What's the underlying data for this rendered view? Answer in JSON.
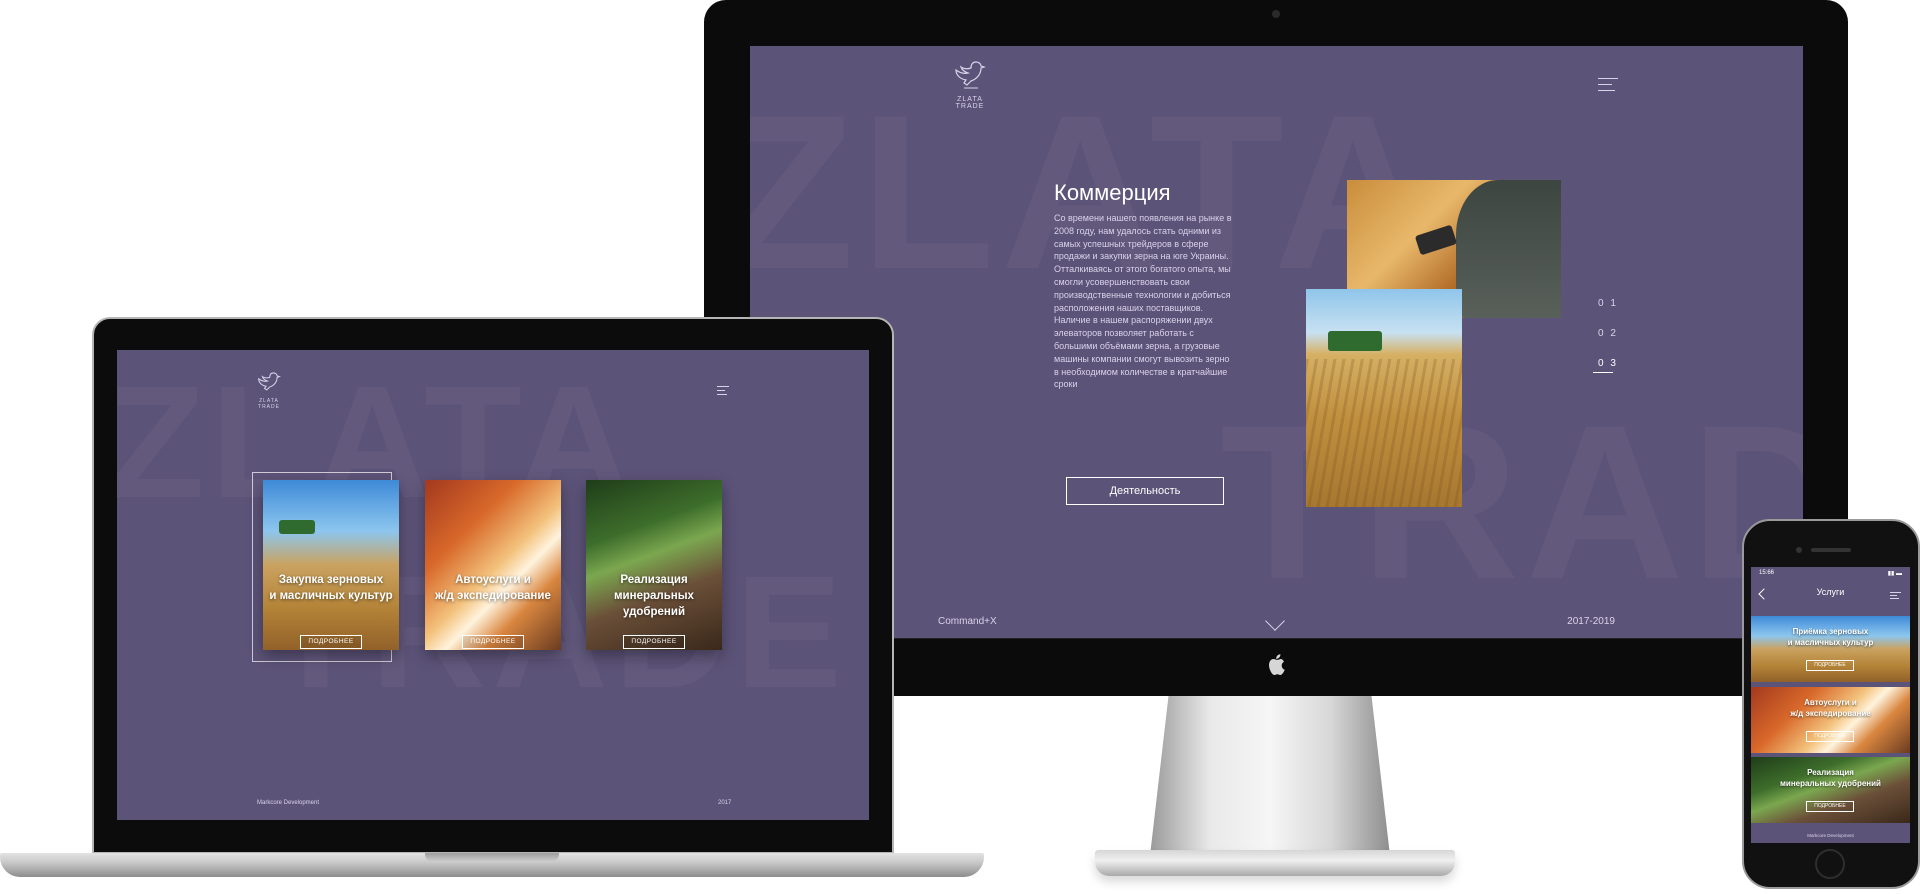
{
  "brand": {
    "logo_text": "ZLATA TRADE",
    "bg_word_1": "ZLATA",
    "bg_word_2": "TRADE"
  },
  "colors": {
    "page_bg": "#ffffff",
    "screen_bg": "#5c5378",
    "text_light": "#d9d3ea",
    "accent": "#ffffff"
  },
  "desktop": {
    "title": "Коммерция",
    "body": "Со времени нашего появления на рынке в 2008 году, нам удалось стать одними из самых успешных трейдеров в сфере продажи и закупки зерна на юге Украины. Отталкиваясь от этого богатого опыта, мы смогли усовершенствовать свои производственные технологии и добиться расположения наших поставщиков. Наличие в нашем распоряжении двух элеваторов позволяет работать с большими объёмами зерна, а грузовые машины компании смогут вывозить зерно в необходимом количестве в кратчайшие сроки",
    "button_label": "Деятельность",
    "nav": [
      "0 1",
      "0 2",
      "0 3"
    ],
    "footer_left": "Command+X",
    "footer_right": "2017-2019",
    "icons": [
      "eagle-logo-icon",
      "menu-icon",
      "chevron-down-icon",
      "apple-logo-icon"
    ]
  },
  "laptop": {
    "cards": [
      {
        "title_line1": "Закупка зерновых",
        "title_line2": "и масличных культур",
        "button": "ПОДРОБНЕЕ"
      },
      {
        "title_line1": "Автоуслуги и",
        "title_line2": "ж/д экспедирование",
        "button": "ПОДРОБНЕЕ"
      },
      {
        "title_line1": "Реализация",
        "title_line2": "минеральных удобрений",
        "button": "ПОДРОБНЕЕ"
      }
    ],
    "footer_left": "Markcore Development",
    "footer_right": "2017"
  },
  "phone": {
    "status_time": "15:66",
    "status_right": "▮▮ ▬",
    "title": "Услуги",
    "cards": [
      {
        "title_line1": "Приёмка зерновых",
        "title_line2": "и масличных культур",
        "button": "ПОДРОБНЕЕ"
      },
      {
        "title_line1": "Автоуслуги и",
        "title_line2": "ж/д экспедирование",
        "button": "ПОДРОБНЕЕ"
      },
      {
        "title_line1": "Реализация",
        "title_line2": "минеральных удобрений",
        "button": "ПОДРОБНЕЕ"
      }
    ],
    "footer": "Markcore Development"
  }
}
